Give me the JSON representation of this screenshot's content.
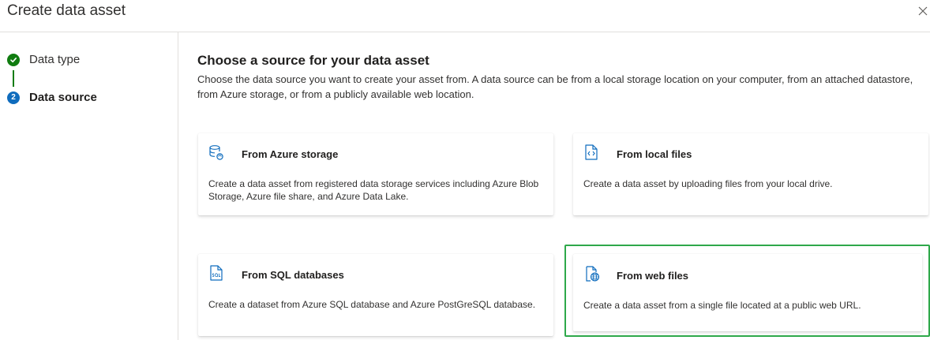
{
  "dialog": {
    "title": "Create data asset",
    "close_icon": "close-icon"
  },
  "steps": [
    {
      "label": "Data type",
      "status": "completed",
      "icon": "checkmark-icon"
    },
    {
      "label": "Data source",
      "status": "current",
      "number": "2"
    }
  ],
  "main": {
    "title": "Choose a source for your data asset",
    "description": "Choose the data source you want to create your asset from. A data source can be from a local storage location on your computer, from an attached datastore, from Azure storage, or from a publicly available web location."
  },
  "cards": [
    {
      "title": "From Azure storage",
      "description": "Create a data asset from registered data storage services including Azure Blob Storage, Azure file share, and Azure Data Lake.",
      "icon": "storage-icon"
    },
    {
      "title": "From local files",
      "description": "Create a data asset by uploading files from your local drive.",
      "icon": "code-file-icon"
    },
    {
      "title": "From SQL databases",
      "description": "Create a dataset from Azure SQL database and Azure PostGreSQL database.",
      "icon": "sql-file-icon"
    },
    {
      "title": "From web files",
      "description": "Create a data asset from a single file located at a public web URL.",
      "icon": "web-file-icon",
      "selected": true
    }
  ],
  "colors": {
    "step_complete": "#107c10",
    "step_current": "#0f6cbd",
    "icon_accent": "#0f6cbd",
    "selected_outline": "#2ea84a"
  }
}
